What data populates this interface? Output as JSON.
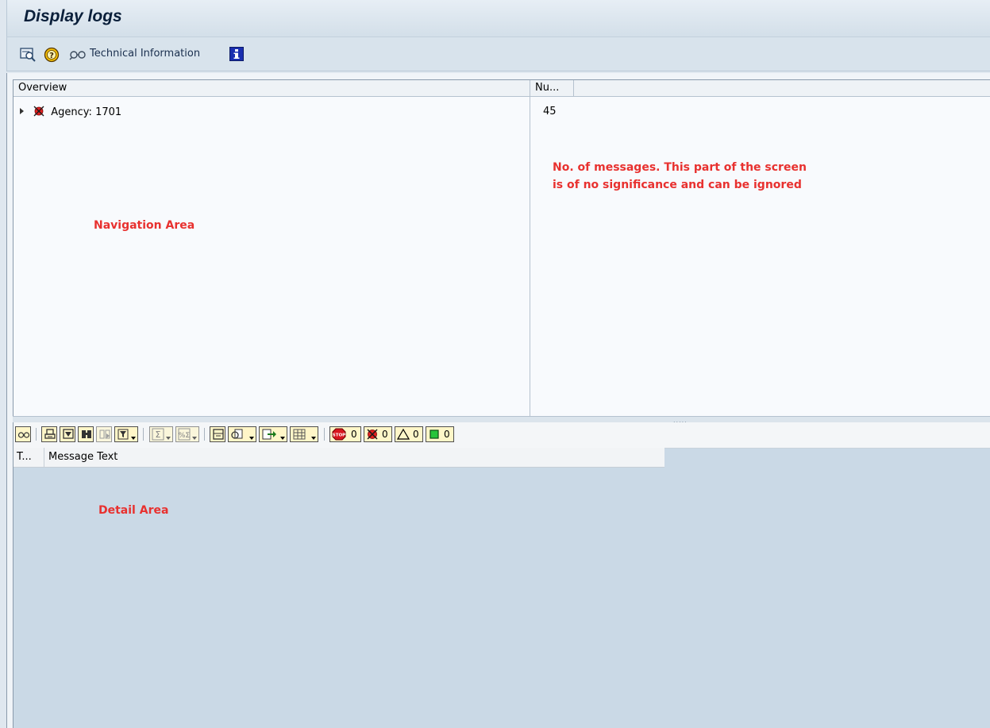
{
  "title": "Display logs",
  "appbar": {
    "technical_info_label": "Technical Information"
  },
  "overview": {
    "column_overview": "Overview",
    "column_count": "Nu...",
    "tree_item_label": "Agency: 1701",
    "tree_item_count": "45"
  },
  "alv_toolbar": {
    "count_stop": "0",
    "count_error": "0",
    "count_warning": "0",
    "count_success": "0"
  },
  "detail": {
    "column_type": "T...",
    "column_message": "Message Text"
  },
  "annotations": {
    "count_note_line1": "No. of messages. This part of the screen",
    "count_note_line2": "is of no significance and can be ignored",
    "navigation_area": "Navigation Area",
    "detail_area": "Detail Area"
  },
  "colors": {
    "annotation": "#e8312f",
    "toolbar_button_fill": "#fff6c8",
    "detail_background": "#cad9e6"
  }
}
